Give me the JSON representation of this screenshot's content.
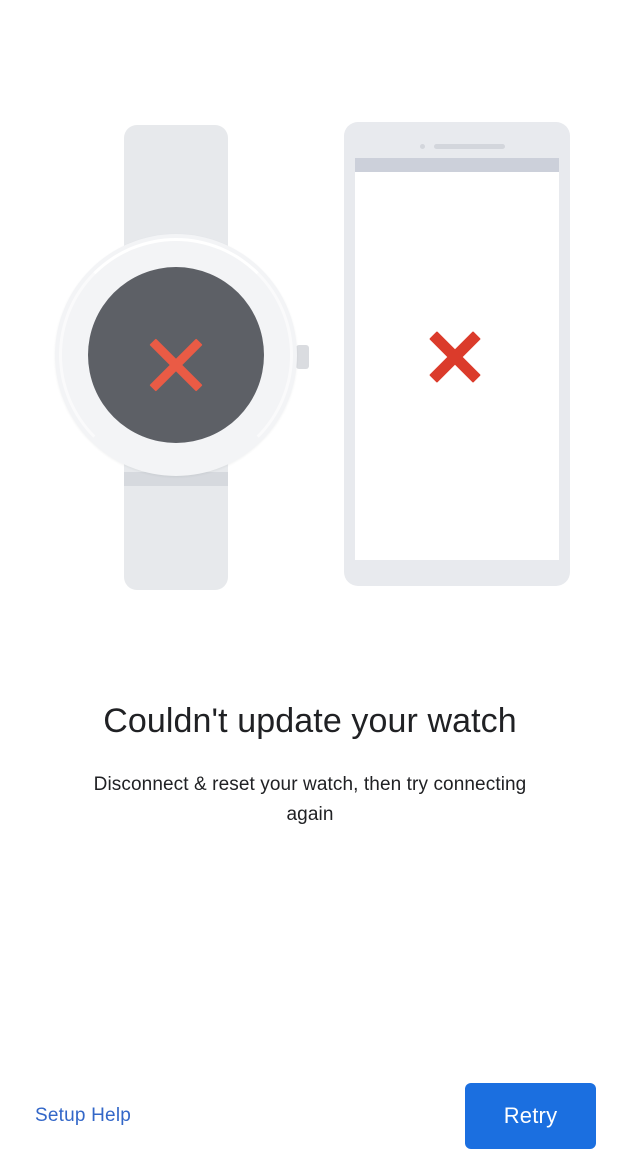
{
  "screen": {
    "name": "watch-update-failed-screen",
    "background_color": "#FFFFFF"
  },
  "illustration": {
    "name": "watch-phone-error-illustration",
    "watch": {
      "icon": "watch-error-icon",
      "strap_color": "#E7E9EC",
      "case_color": "#F3F4F6",
      "face_color": "#5D6066",
      "x_mark_color": "#EA5B45",
      "x_mark_icon": "x-mark-icon",
      "crown_color": "#DADCE0"
    },
    "phone": {
      "icon": "phone-error-icon",
      "body_color": "#E8EAEE",
      "screen_color": "#FFFFFF",
      "status_bar_color": "#CCD0DA",
      "x_mark_color": "#DB3B2B",
      "x_mark_icon": "x-mark-icon",
      "camera_icon": "camera-dot-icon",
      "speaker_icon": "speaker-slot-icon"
    }
  },
  "content": {
    "headline": "Couldn't update your watch",
    "subtitle": "Disconnect & reset your watch, then try connecting again",
    "headline_color": "#202124",
    "subtitle_color": "#202124"
  },
  "actions": {
    "help_link_label": "Setup Help",
    "help_link_color": "#3367C8",
    "retry_button_label": "Retry",
    "retry_button_color": "#1B6FE0",
    "retry_button_text_color": "#FFFFFF"
  }
}
